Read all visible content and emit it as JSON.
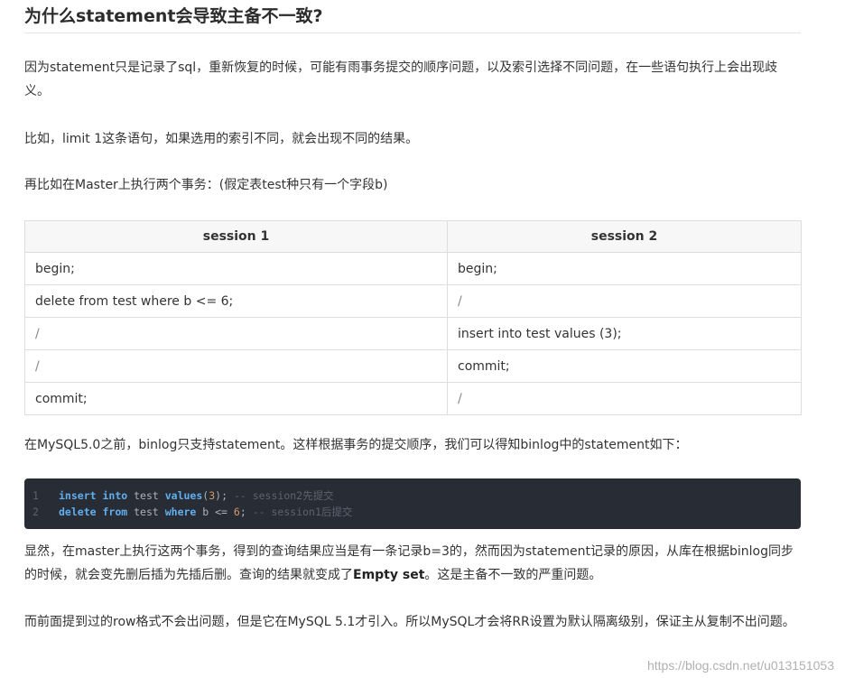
{
  "title": "为什么statement会导致主备不一致?",
  "paragraphs": {
    "p1": "因为statement只是记录了sql，重新恢复的时候，可能有雨事务提交的顺序问题，以及索引选择不同问题，在一些语句执行上会出现歧义。",
    "p2": "比如，limit 1这条语句，如果选用的索引不同，就会出现不同的结果。",
    "p3": "再比如在Master上执行两个事务：(假定表test种只有一个字段b)",
    "p4": "在MySQL5.0之前，binlog只支持statement。这样根据事务的提交顺序，我们可以得知binlog中的statement如下：",
    "p5_before": "显然，在master上执行这两个事务，得到的查询结果应当是有一条记录b=3的，然而因为statement记录的原因，从库在根据binlog同步的时候，就会变先删后插为先插后删。查询的结果就变成了",
    "p5_bold": "Empty set",
    "p5_after": "。这是主备不一致的严重问题。",
    "p6": "而前面提到过的row格式不会出问题，但是它在MySQL 5.1才引入。所以MySQL才会将RR设置为默认隔离级别，保证主从复制不出问题。"
  },
  "table": {
    "headers": [
      "session 1",
      "session 2"
    ],
    "rows": [
      [
        "begin;",
        "begin;"
      ],
      [
        "delete from test where b <= 6;",
        "/"
      ],
      [
        "/",
        "insert into test values (3);"
      ],
      [
        "/",
        "commit;"
      ],
      [
        "commit;",
        "/"
      ]
    ]
  },
  "code": {
    "lines": [
      {
        "num": "1",
        "tokens": [
          {
            "t": "insert",
            "c": "kw"
          },
          {
            "t": " ",
            "c": "id"
          },
          {
            "t": "into",
            "c": "kw"
          },
          {
            "t": " test ",
            "c": "id"
          },
          {
            "t": "values",
            "c": "kw"
          },
          {
            "t": "(",
            "c": "id"
          },
          {
            "t": "3",
            "c": "num"
          },
          {
            "t": "); ",
            "c": "id"
          },
          {
            "t": "-- session2先提交",
            "c": "cm"
          }
        ]
      },
      {
        "num": "2",
        "tokens": [
          {
            "t": "delete",
            "c": "kw"
          },
          {
            "t": " ",
            "c": "id"
          },
          {
            "t": "from",
            "c": "kw"
          },
          {
            "t": " test ",
            "c": "id"
          },
          {
            "t": "where",
            "c": "kw"
          },
          {
            "t": " b <= ",
            "c": "id"
          },
          {
            "t": "6",
            "c": "num"
          },
          {
            "t": "; ",
            "c": "id"
          },
          {
            "t": "-- session1后提交",
            "c": "cm"
          }
        ]
      }
    ]
  },
  "watermark": "https://blog.csdn.net/u013151053"
}
